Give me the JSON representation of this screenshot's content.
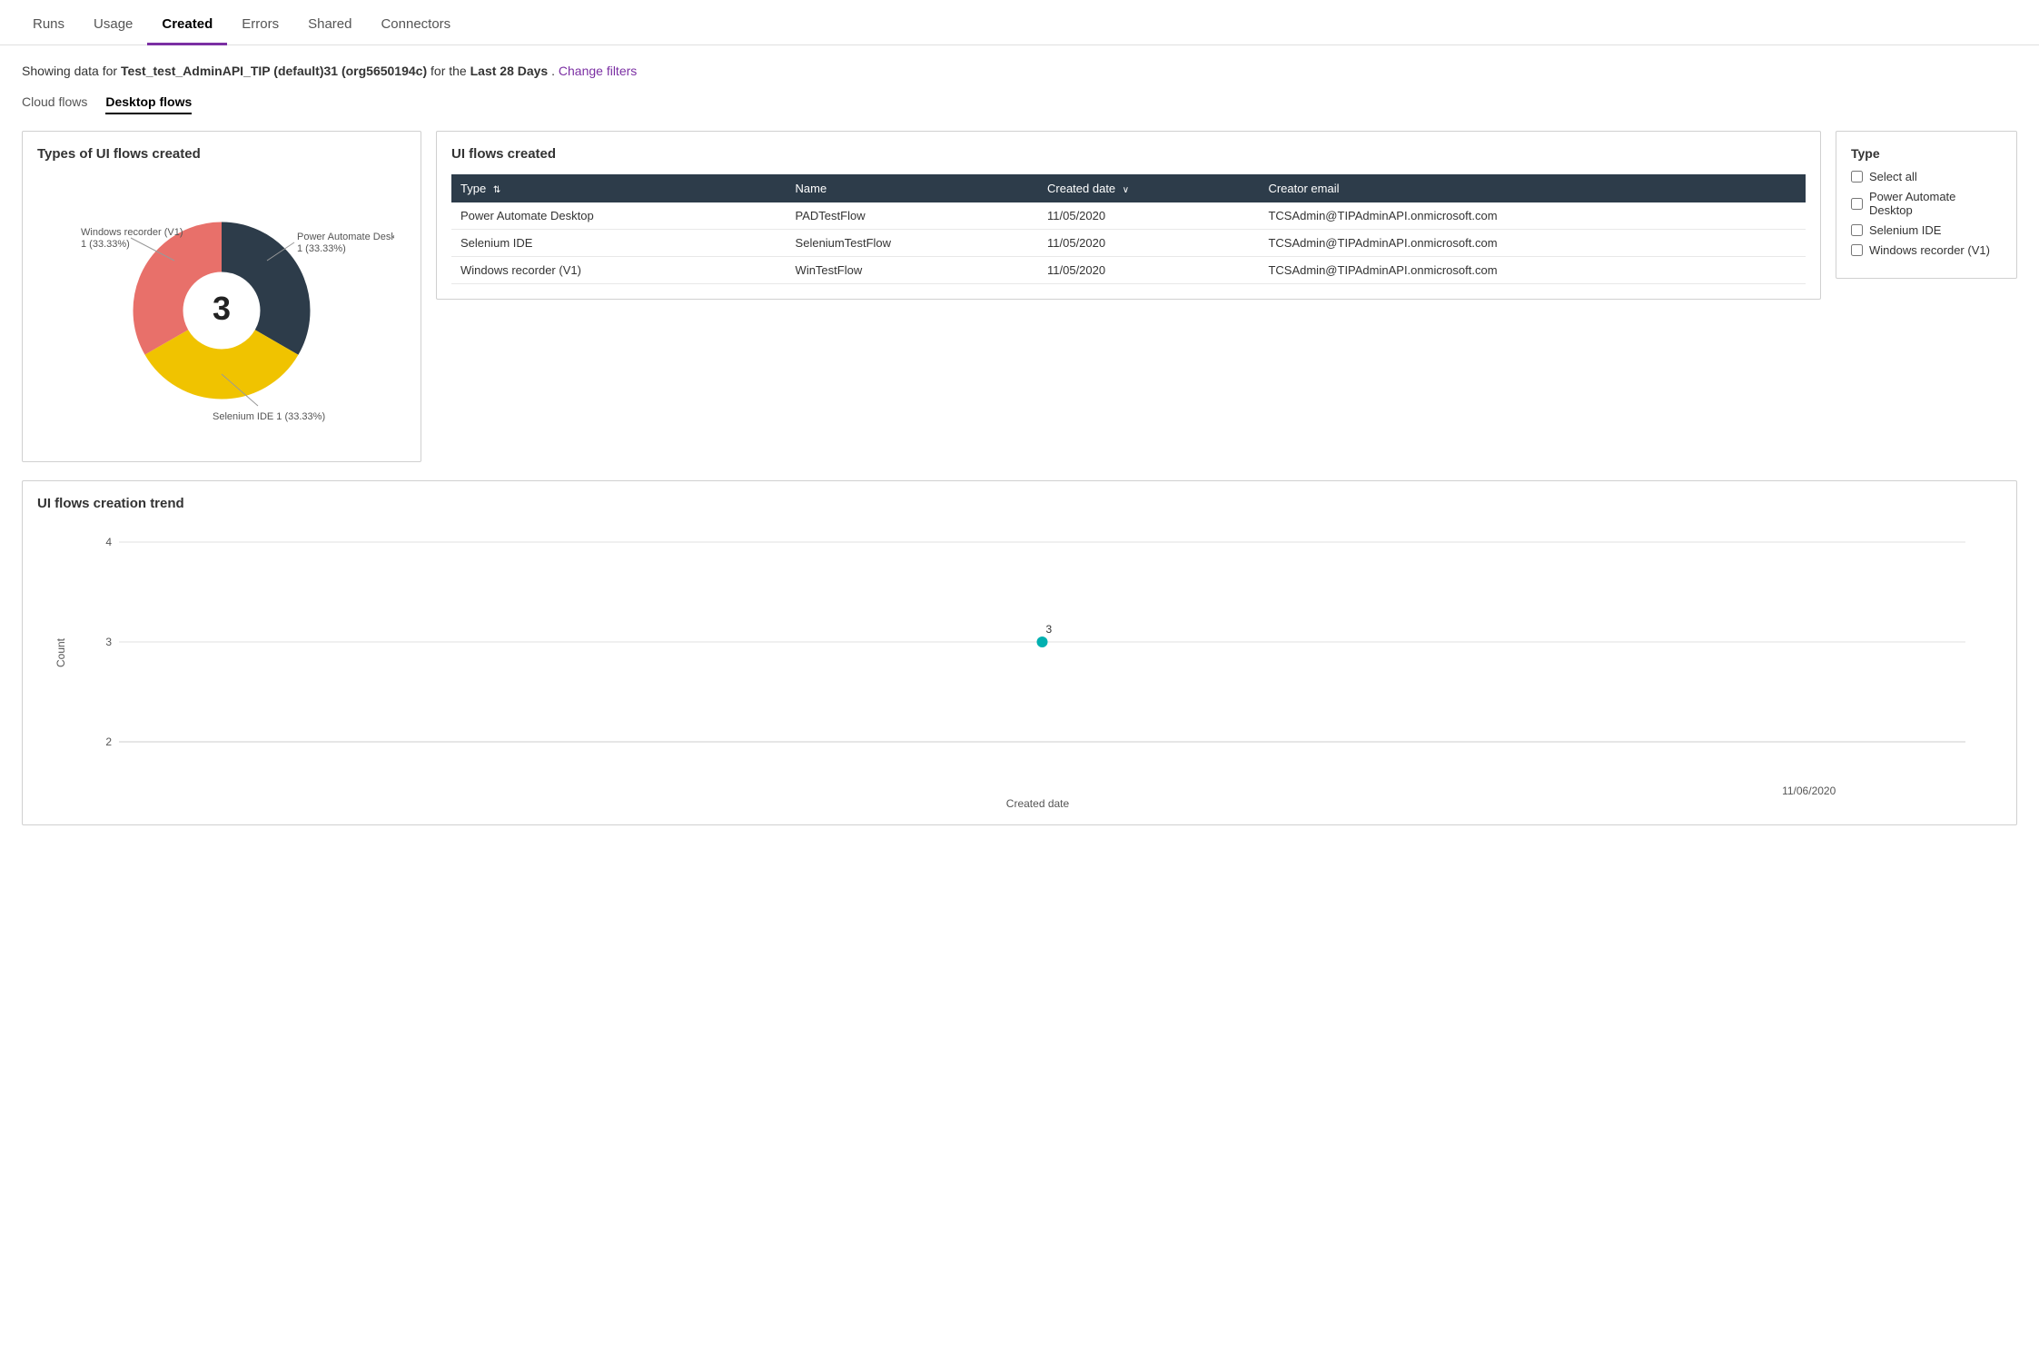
{
  "nav": {
    "items": [
      {
        "label": "Runs",
        "active": false
      },
      {
        "label": "Usage",
        "active": false
      },
      {
        "label": "Created",
        "active": true
      },
      {
        "label": "Errors",
        "active": false
      },
      {
        "label": "Shared",
        "active": false
      },
      {
        "label": "Connectors",
        "active": false
      }
    ]
  },
  "filter_info": {
    "prefix": "Showing data for",
    "org": "Test_test_AdminAPI_TIP (default)31 (org5650194c)",
    "mid": "for the",
    "period": "Last 28 Days",
    "suffix": ".",
    "change_link": "Change filters"
  },
  "sub_tabs": [
    {
      "label": "Cloud flows",
      "active": false
    },
    {
      "label": "Desktop flows",
      "active": true
    }
  ],
  "donut_chart": {
    "title": "Types of UI flows created",
    "center_value": "3",
    "segments": [
      {
        "label": "Power Automate Desktop",
        "value": "1 (33.33%)",
        "color": "#2d3c4a",
        "percent": 33.33
      },
      {
        "label": "Selenium IDE",
        "value": "1 (33.33%)",
        "color": "#e8706a",
        "percent": 33.33
      },
      {
        "label": "Windows recorder (V1)",
        "value": "1 (33.33%)",
        "color": "#f0c300",
        "percent": 33.33
      }
    ]
  },
  "table": {
    "title": "UI flows created",
    "columns": [
      {
        "label": "Type",
        "sortable": true
      },
      {
        "label": "Name",
        "sortable": false
      },
      {
        "label": "Created date",
        "sortable": true,
        "active_sort": true
      },
      {
        "label": "Creator email",
        "sortable": false
      }
    ],
    "rows": [
      {
        "type": "Power Automate Desktop",
        "name": "PADTestFlow",
        "created_date": "11/05/2020",
        "email": "TCSAdmin@TIPAdminAPI.onmicrosoft.com"
      },
      {
        "type": "Selenium IDE",
        "name": "SeleniumTestFlow",
        "created_date": "11/05/2020",
        "email": "TCSAdmin@TIPAdminAPI.onmicrosoft.com"
      },
      {
        "type": "Windows recorder (V1)",
        "name": "WinTestFlow",
        "created_date": "11/05/2020",
        "email": "TCSAdmin@TIPAdminAPI.onmicrosoft.com"
      }
    ]
  },
  "filter_panel": {
    "title": "Type",
    "select_all_label": "Select all",
    "options": [
      {
        "label": "Power Automate Desktop",
        "checked": false
      },
      {
        "label": "Selenium IDE",
        "checked": false
      },
      {
        "label": "Windows recorder (V1)",
        "checked": false
      }
    ]
  },
  "trend_chart": {
    "title": "UI flows creation trend",
    "y_label": "Count",
    "x_label": "Created date",
    "y_min": 2,
    "y_max": 4,
    "y_ticks": [
      2,
      3,
      4
    ],
    "data_point": {
      "x_label": "11/06/2020",
      "y_value": 3,
      "color": "#00b0b0"
    }
  }
}
